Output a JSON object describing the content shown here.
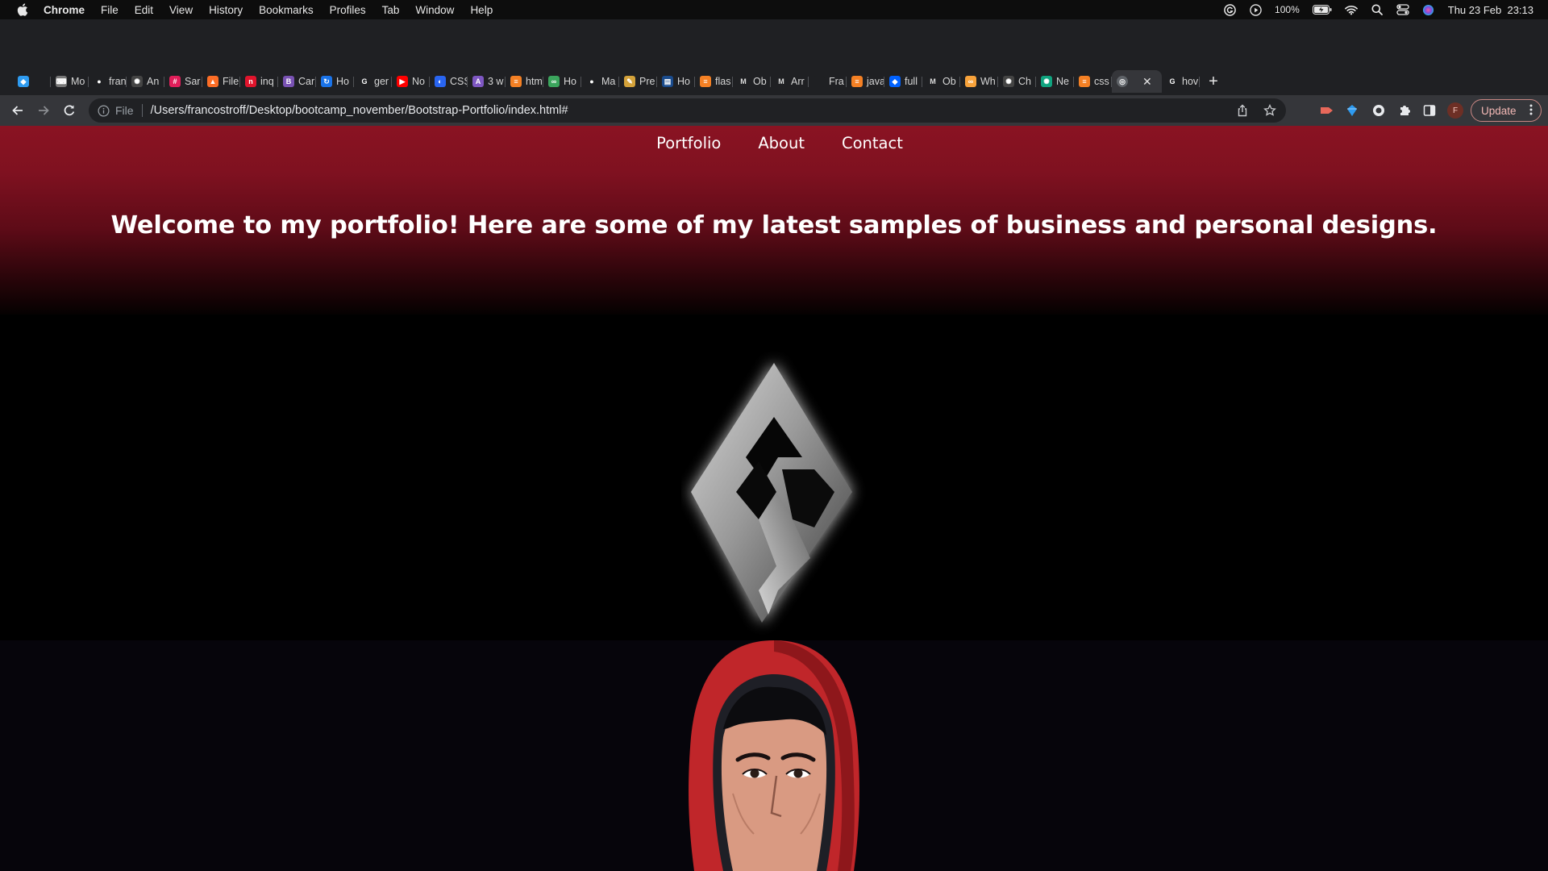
{
  "menubar": {
    "app_name": "Chrome",
    "items": [
      "File",
      "Edit",
      "View",
      "History",
      "Bookmarks",
      "Profiles",
      "Tab",
      "Window",
      "Help"
    ],
    "battery": "100%",
    "datetime": "Thu 23 Feb  23:13"
  },
  "tabs": [
    {
      "icon": "gem-icon",
      "label": "",
      "color": "#2e9bf0"
    },
    {
      "icon": "monkeytype-icon",
      "label": "Mo",
      "color": "#777777"
    },
    {
      "icon": "github-icon",
      "label": "fran",
      "color": "#ffffff"
    },
    {
      "icon": "openai-icon",
      "label": "An",
      "color": "#444444"
    },
    {
      "icon": "slack-icon",
      "label": "Sar",
      "color": "#e01e5a"
    },
    {
      "icon": "gitlab-icon",
      "label": "File",
      "color": "#fc6d26"
    },
    {
      "icon": "inq-icon",
      "label": "inq",
      "color": "#e0142c"
    },
    {
      "icon": "bootstrap-icon",
      "label": "Car",
      "color": "#7952b3"
    },
    {
      "icon": "refresh-blue-icon",
      "label": "Ho",
      "color": "#1a73e8"
    },
    {
      "icon": "google-icon",
      "label": "ger",
      "color": "#ffffff"
    },
    {
      "icon": "youtube-icon",
      "label": "No",
      "color": "#ff0000"
    },
    {
      "icon": "css-icon",
      "label": "CSS",
      "color": "#2965f1"
    },
    {
      "icon": "w3-icon",
      "label": "3 w",
      "color": "#7e57c2"
    },
    {
      "icon": "stackoverflow-icon",
      "label": "htm",
      "color": "#f48024"
    },
    {
      "icon": "link-icon",
      "label": "Ho",
      "color": "#3ba55d"
    },
    {
      "icon": "github-icon",
      "label": "Ma",
      "color": "#ffffff"
    },
    {
      "icon": "pen-icon",
      "label": "Pre",
      "color": "#d4a23a"
    },
    {
      "icon": "doc-icon",
      "label": "Ho",
      "color": "#1a4b8c"
    },
    {
      "icon": "stackoverflow-icon",
      "label": "flas",
      "color": "#f48024"
    },
    {
      "icon": "medium-icon",
      "label": "Ob",
      "color": "#dddddd"
    },
    {
      "icon": "medium-icon",
      "label": "Arr",
      "color": "#dddddd"
    },
    {
      "icon": "blank-icon",
      "label": "Fra",
      "color": "#1f2023"
    },
    {
      "icon": "stackoverflow-icon",
      "label": "java",
      "color": "#f48024"
    },
    {
      "icon": "dropbox-icon",
      "label": "full",
      "color": "#0061fe"
    },
    {
      "icon": "medium-icon",
      "label": "Ob",
      "color": "#dddddd"
    },
    {
      "icon": "bike-icon",
      "label": "Wh",
      "color": "#f7a23b"
    },
    {
      "icon": "openai-icon",
      "label": "Ch",
      "color": "#444444"
    },
    {
      "icon": "chatgpt-icon",
      "label": "Ne",
      "color": "#10a37f"
    },
    {
      "icon": "stackoverflow-icon",
      "label": "css",
      "color": "#f48024"
    },
    {
      "icon": "globe-icon",
      "label": "",
      "color": "#9aa0a6",
      "active": true
    },
    {
      "icon": "google-icon",
      "label": "hov",
      "color": "#ffffff"
    }
  ],
  "toolbar": {
    "scheme": "File",
    "url": "/Users/francostroff/Desktop/bootcamp_november/Bootstrap-Portfolio/index.html#",
    "update_label": "Update",
    "profile_initial": "F"
  },
  "page": {
    "nav": [
      "Portfolio",
      "About",
      "Contact"
    ],
    "welcome": "Welcome to my portfolio! Here are some of my latest samples of business and personal designs."
  },
  "colors": {
    "hero_top": "#8a1322",
    "hero_bottom": "#050101",
    "hood_red": "#c0262a",
    "skin": "#d99a82",
    "update_border": "#c98783"
  }
}
